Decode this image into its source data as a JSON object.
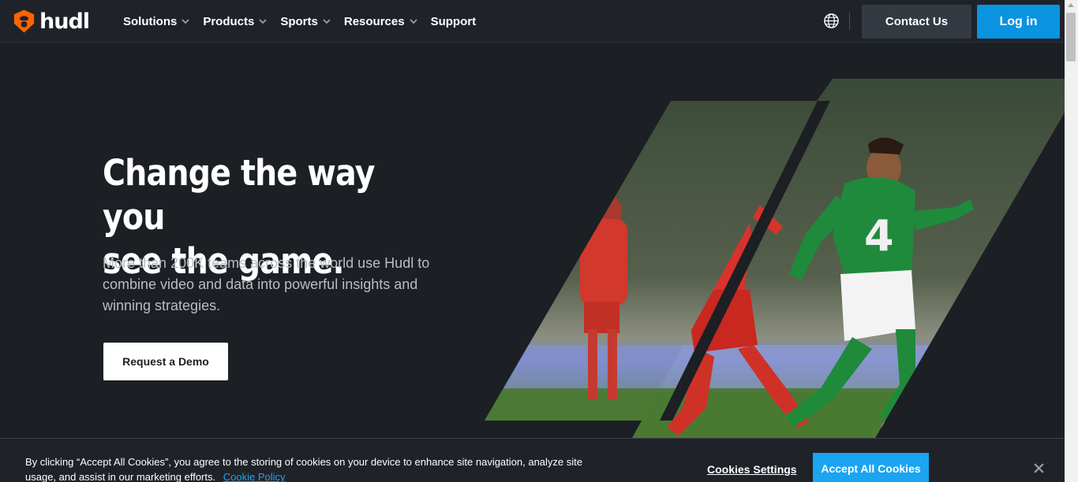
{
  "header": {
    "brand": "hudl",
    "nav": [
      {
        "label": "Solutions",
        "has_dropdown": true
      },
      {
        "label": "Products",
        "has_dropdown": true
      },
      {
        "label": "Sports",
        "has_dropdown": true
      },
      {
        "label": "Resources",
        "has_dropdown": true
      },
      {
        "label": "Support",
        "has_dropdown": false
      }
    ],
    "language_icon": "globe-icon",
    "contact_label": "Contact Us",
    "login_label": "Log in"
  },
  "hero": {
    "title_line1": "Change the way you",
    "title_line2": "see the game.",
    "subtitle": "More than 200K teams across the world use Hudl to combine video and data into powerful insights and winning strategies.",
    "cta_label": "Request a Demo",
    "image": "soccer-players-action-photo"
  },
  "cookie_banner": {
    "text": "By clicking “Accept All Cookies”, you agree to the storing of cookies on your device to enhance site navigation, analyze site usage, and assist in our marketing efforts.",
    "policy_link": "Cookie Policy",
    "settings_label": "Cookies Settings",
    "accept_label": "Accept All Cookies",
    "close_icon": "close-icon"
  },
  "colors": {
    "background": "#1c1f24",
    "accent_blue": "#0a93e0",
    "brand_orange": "#ff6300"
  }
}
